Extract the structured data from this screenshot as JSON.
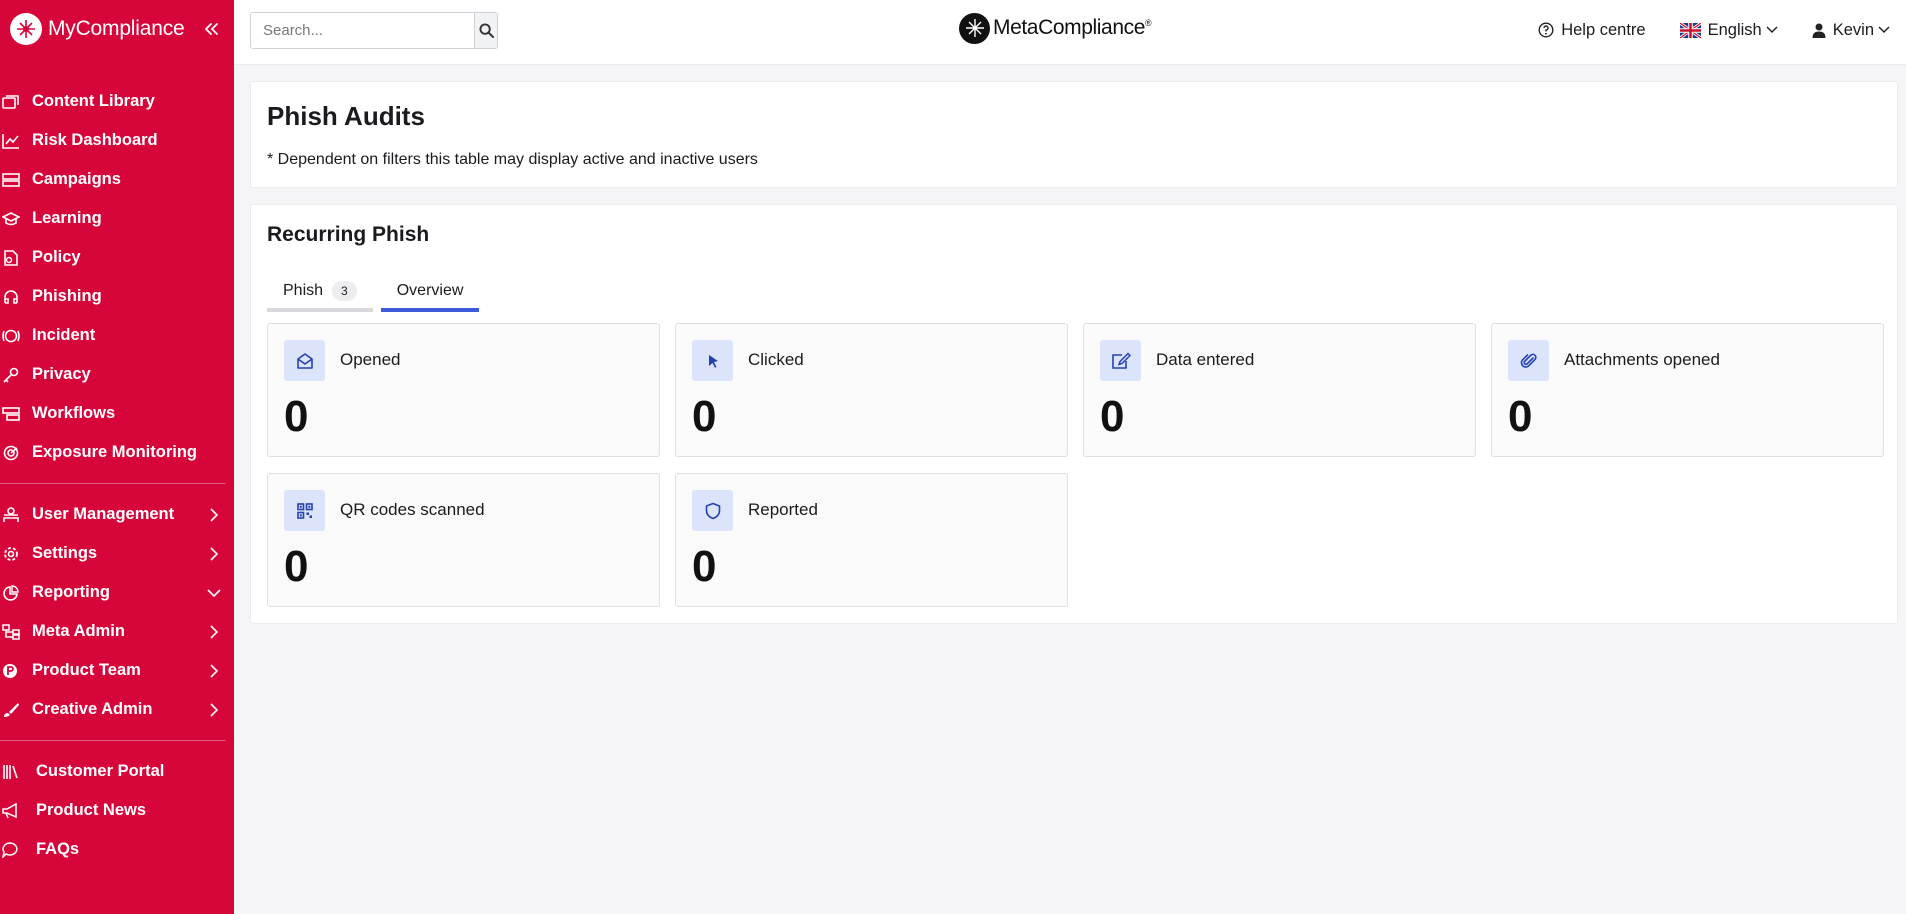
{
  "brand": {
    "name": "MyCompliance"
  },
  "sidebar": {
    "primary": [
      {
        "label": "Content Library",
        "icon": "content-library-icon"
      },
      {
        "label": "Risk Dashboard",
        "icon": "chart-line-icon"
      },
      {
        "label": "Campaigns",
        "icon": "campaigns-icon"
      },
      {
        "label": "Learning",
        "icon": "graduation-cap-icon"
      },
      {
        "label": "Policy",
        "icon": "policy-icon"
      },
      {
        "label": "Phishing",
        "icon": "phishing-hook-icon"
      },
      {
        "label": "Incident",
        "icon": "incident-icon"
      },
      {
        "label": "Privacy",
        "icon": "key-icon"
      },
      {
        "label": "Workflows",
        "icon": "workflows-icon"
      },
      {
        "label": "Exposure Monitoring",
        "icon": "radar-icon"
      }
    ],
    "admin": [
      {
        "label": "User Management",
        "icon": "user-management-icon",
        "arrow": "right"
      },
      {
        "label": "Settings",
        "icon": "gear-icon",
        "arrow": "right"
      },
      {
        "label": "Reporting",
        "icon": "pie-chart-icon",
        "arrow": "down"
      },
      {
        "label": "Meta Admin",
        "icon": "sitemap-icon",
        "arrow": "right"
      },
      {
        "label": "Product Team",
        "icon": "product-p-icon",
        "arrow": "right"
      },
      {
        "label": "Creative Admin",
        "icon": "brush-icon",
        "arrow": "right"
      }
    ],
    "links": [
      {
        "label": "Customer Portal",
        "icon": "books-icon"
      },
      {
        "label": "Product News",
        "icon": "megaphone-icon"
      },
      {
        "label": "FAQs",
        "icon": "faq-bubble-icon"
      }
    ]
  },
  "topbar": {
    "search_placeholder": "Search...",
    "center_logo": "MetaCompliance",
    "center_logo_mark": "®",
    "help": "Help centre",
    "language": "English",
    "user": "Kevin"
  },
  "page": {
    "title": "Phish Audits",
    "note": "* Dependent on filters this table may display active and inactive users"
  },
  "section": {
    "title": "Recurring Phish",
    "tabs": [
      {
        "label": "Phish",
        "badge": "3"
      },
      {
        "label": "Overview"
      }
    ]
  },
  "metrics": [
    {
      "label": "Opened",
      "value": "0",
      "icon": "envelope-open-icon"
    },
    {
      "label": "Clicked",
      "value": "0",
      "icon": "cursor-pointer-icon"
    },
    {
      "label": "Data entered",
      "value": "0",
      "icon": "pen-square-icon"
    },
    {
      "label": "Attachments opened",
      "value": "0",
      "icon": "paperclip-icon"
    },
    {
      "label": "QR codes scanned",
      "value": "0",
      "icon": "qr-code-icon"
    },
    {
      "label": "Reported",
      "value": "0",
      "icon": "shield-icon"
    }
  ],
  "colors": {
    "sidebar_bg": "#d6063b",
    "accent_blue": "#3b5bdb",
    "icon_tile": "#dbe4fb",
    "icon_blue": "#2541b2"
  }
}
